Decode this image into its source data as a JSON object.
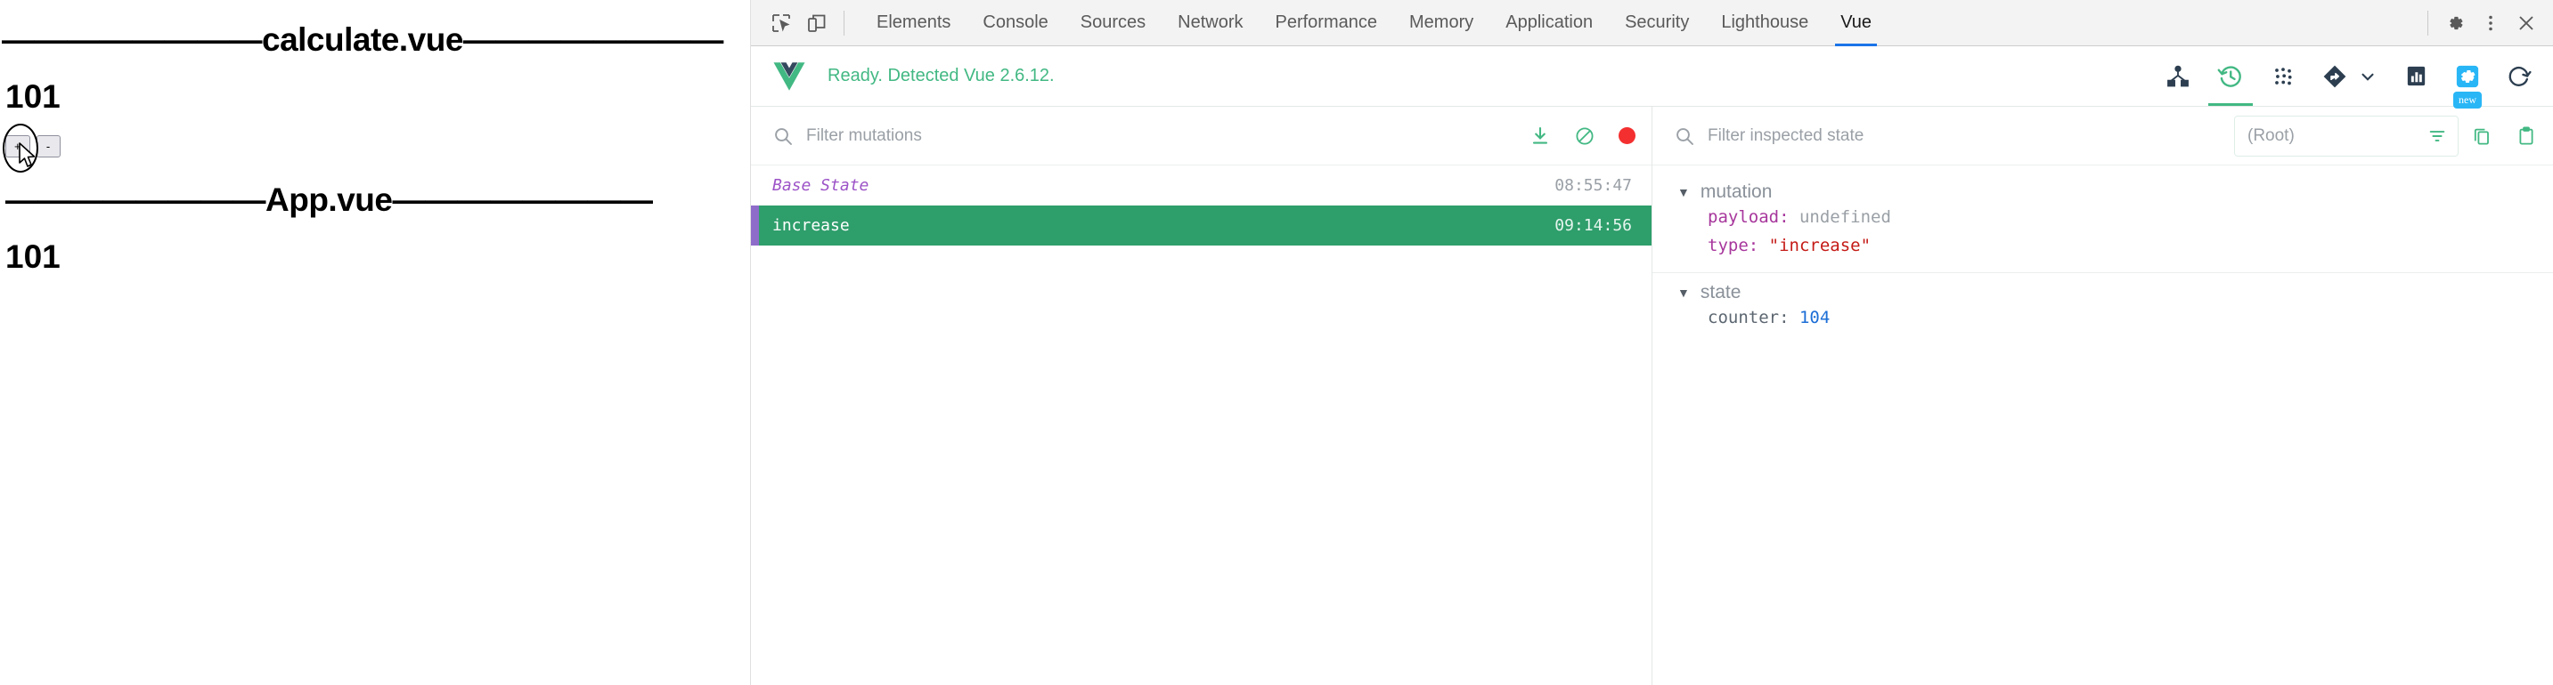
{
  "page": {
    "calculate_heading": "————————calculate.vue————————",
    "calculate_count": "101",
    "increment_button": "+",
    "decrement_button": "-",
    "app_heading": "————————App.vue————————",
    "app_count": "101"
  },
  "devtools": {
    "icons": {
      "inspect": "inspect-element-icon",
      "device": "device-toolbar-icon",
      "settings": "gear-icon",
      "more": "kebab-menu-icon",
      "close": "close-icon"
    },
    "tabs": [
      {
        "label": "Elements",
        "active": false
      },
      {
        "label": "Console",
        "active": false
      },
      {
        "label": "Sources",
        "active": false
      },
      {
        "label": "Network",
        "active": false
      },
      {
        "label": "Performance",
        "active": false
      },
      {
        "label": "Memory",
        "active": false
      },
      {
        "label": "Application",
        "active": false
      },
      {
        "label": "Security",
        "active": false
      },
      {
        "label": "Lighthouse",
        "active": false
      },
      {
        "label": "Vue",
        "active": true
      }
    ]
  },
  "vue_panel": {
    "logo": "vue-logo-icon",
    "status": "Ready. Detected Vue 2.6.12.",
    "status_color": "#42b883",
    "tools": [
      {
        "name": "components-tree-icon",
        "active": false,
        "accent": false,
        "badge": ""
      },
      {
        "name": "vuex-history-icon",
        "active": true,
        "accent": false,
        "badge": ""
      },
      {
        "name": "events-icon",
        "active": false,
        "accent": false,
        "badge": ""
      },
      {
        "name": "routing-icon",
        "active": false,
        "accent": false,
        "badge": ""
      },
      {
        "name": "performance-icon",
        "active": false,
        "accent": false,
        "badge": ""
      },
      {
        "name": "settings-icon",
        "active": false,
        "accent": true,
        "badge": "new"
      },
      {
        "name": "refresh-icon",
        "active": false,
        "accent": false,
        "badge": ""
      }
    ]
  },
  "mutations_panel": {
    "filter_placeholder": "Filter mutations",
    "filter_value": "",
    "actions": [
      {
        "name": "import-export-icon",
        "color": "#42b883"
      },
      {
        "name": "clear-mutations-icon",
        "color": "#42b883"
      },
      {
        "name": "record-toggle-icon",
        "color": "#f42f2f"
      }
    ],
    "rows": [
      {
        "name": "Base State",
        "time": "08:55:47",
        "selected": false
      },
      {
        "name": "increase",
        "time": "09:14:56",
        "selected": true
      }
    ]
  },
  "inspector_panel": {
    "filter_placeholder": "Filter inspected state",
    "filter_value": "",
    "root_selector": "(Root)",
    "actions": [
      {
        "name": "filter-icon"
      },
      {
        "name": "copy-icon"
      },
      {
        "name": "paste-clipboard-icon"
      }
    ],
    "groups": [
      {
        "title": "mutation",
        "rows": [
          {
            "key": "payload",
            "key_style": "k-purple",
            "value": "undefined",
            "value_style": "v-gray"
          },
          {
            "key": "type",
            "key_style": "k-purple",
            "value": "\"increase\"",
            "value_style": "v-red"
          }
        ]
      },
      {
        "title": "state",
        "rows": [
          {
            "key": "counter",
            "key_style": "k-gray",
            "value": "104",
            "value_style": "v-blue"
          }
        ]
      }
    ]
  },
  "colors": {
    "vue_green": "#42b883",
    "selected_row_green": "#2e9e6b",
    "selected_accent_purple": "#8e6cc9",
    "devtools_tab_active_blue": "#1a73e8",
    "badge_cyan": "#29b6f6",
    "record_red": "#f42f2f"
  }
}
